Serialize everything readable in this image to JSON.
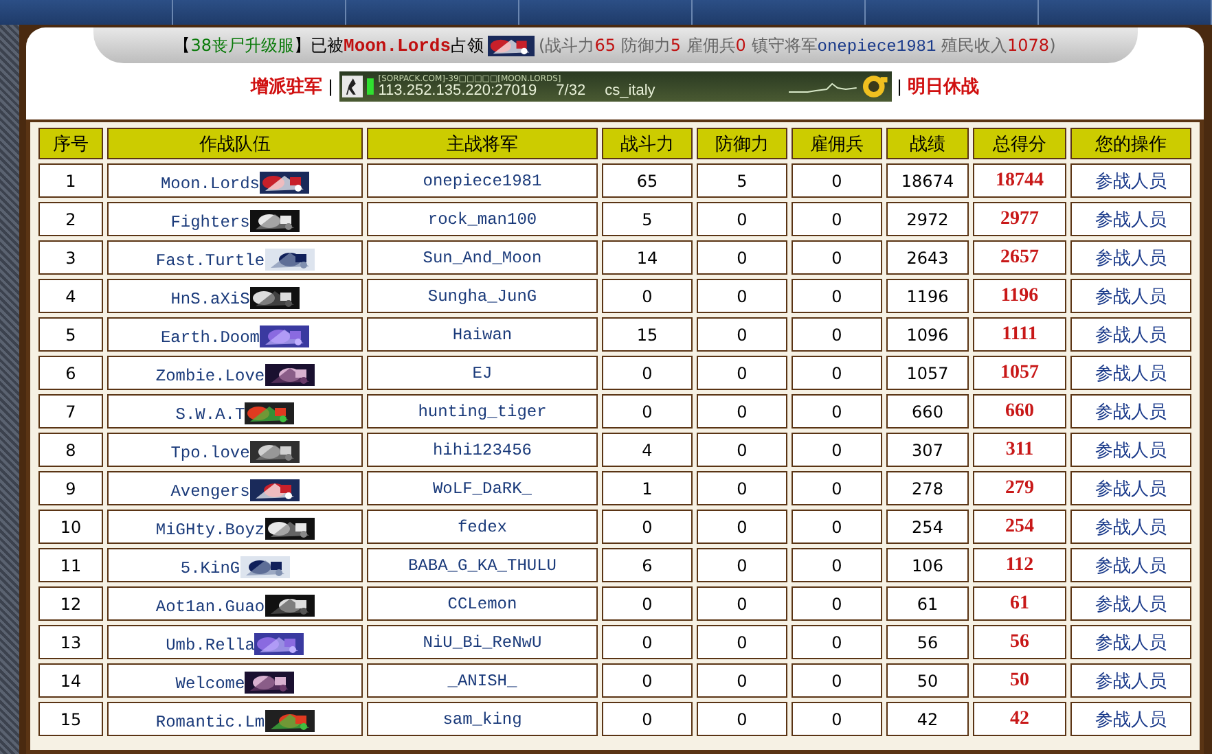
{
  "notice": {
    "before": [
      {
        "kind": "text",
        "text": "【"
      },
      {
        "kind": "server",
        "text": "38丧尸升级服"
      },
      {
        "kind": "text",
        "text": "】已被"
      },
      {
        "kind": "team",
        "text": "Moon.Lords"
      },
      {
        "kind": "text",
        "text": "占领"
      }
    ],
    "after": [
      {
        "kind": "muted",
        "text": "(战斗力"
      },
      {
        "kind": "value",
        "text": "65"
      },
      {
        "kind": "muted",
        "text": " 防御力"
      },
      {
        "kind": "value",
        "text": "5"
      },
      {
        "kind": "muted",
        "text": " 雇佣兵"
      },
      {
        "kind": "value",
        "text": "0"
      },
      {
        "kind": "muted",
        "text": " 镇守将军"
      },
      {
        "kind": "general",
        "text": "onepiece1981"
      },
      {
        "kind": "muted",
        "text": " 殖民收入"
      },
      {
        "kind": "value",
        "text": "1078"
      },
      {
        "kind": "muted",
        "text": ")"
      }
    ]
  },
  "actions": {
    "left": "增派驻军",
    "right": "明日休战",
    "separator": "|"
  },
  "server_banner": {
    "name": "[SORPACK.COM]-39□□□□□[MOON.LORDS]",
    "address": "113.252.135.220:27019",
    "players": "7/32",
    "map": "cs_italy"
  },
  "table": {
    "columns": [
      "序号",
      "作战队伍",
      "主战将军",
      "战斗力",
      "防御力",
      "雇佣兵",
      "战绩",
      "总得分",
      "您的操作"
    ],
    "rows": [
      {
        "rank": "1",
        "team": "Moon.Lords",
        "general": "onepiece1981",
        "attack": "65",
        "defense": "5",
        "mercenaries": "0",
        "record": "18674",
        "total": "18744",
        "action": "参战人员"
      },
      {
        "rank": "2",
        "team": "Fighters",
        "general": "rock_man100",
        "attack": "5",
        "defense": "0",
        "mercenaries": "0",
        "record": "2972",
        "total": "2977",
        "action": "参战人员"
      },
      {
        "rank": "3",
        "team": "Fast.Turtle",
        "general": "Sun_And_Moon",
        "attack": "14",
        "defense": "0",
        "mercenaries": "0",
        "record": "2643",
        "total": "2657",
        "action": "参战人员"
      },
      {
        "rank": "4",
        "team": "HnS.aXiS",
        "general": "Sungha_JunG",
        "attack": "0",
        "defense": "0",
        "mercenaries": "0",
        "record": "1196",
        "total": "1196",
        "action": "参战人员"
      },
      {
        "rank": "5",
        "team": "Earth.Doom",
        "general": "Haiwan",
        "attack": "15",
        "defense": "0",
        "mercenaries": "0",
        "record": "1096",
        "total": "1111",
        "action": "参战人员"
      },
      {
        "rank": "6",
        "team": "Zombie.Love",
        "general": "EJ",
        "attack": "0",
        "defense": "0",
        "mercenaries": "0",
        "record": "1057",
        "total": "1057",
        "action": "参战人员"
      },
      {
        "rank": "7",
        "team": "S.W.A.T",
        "general": "hunting_tiger",
        "attack": "0",
        "defense": "0",
        "mercenaries": "0",
        "record": "660",
        "total": "660",
        "action": "参战人员"
      },
      {
        "rank": "8",
        "team": "Tpo.love",
        "general": "hihi123456",
        "attack": "4",
        "defense": "0",
        "mercenaries": "0",
        "record": "307",
        "total": "311",
        "action": "参战人员"
      },
      {
        "rank": "9",
        "team": "Avengers",
        "general": "WoLF_DaRK_",
        "attack": "1",
        "defense": "0",
        "mercenaries": "0",
        "record": "278",
        "total": "279",
        "action": "参战人员"
      },
      {
        "rank": "10",
        "team": "MiGHty.Boyz",
        "general": "fedex",
        "attack": "0",
        "defense": "0",
        "mercenaries": "0",
        "record": "254",
        "total": "254",
        "action": "参战人员"
      },
      {
        "rank": "11",
        "team": "5.KinG",
        "general": "BABA_G_KA_THULU",
        "attack": "6",
        "defense": "0",
        "mercenaries": "0",
        "record": "106",
        "total": "112",
        "action": "参战人员"
      },
      {
        "rank": "12",
        "team": "Aot1an.Guao",
        "general": "CCLemon",
        "attack": "0",
        "defense": "0",
        "mercenaries": "0",
        "record": "61",
        "total": "61",
        "action": "参战人员"
      },
      {
        "rank": "13",
        "team": "Umb.Rella",
        "general": "NiU_Bi_ReNwU",
        "attack": "0",
        "defense": "0",
        "mercenaries": "0",
        "record": "56",
        "total": "56",
        "action": "参战人员"
      },
      {
        "rank": "14",
        "team": "Welcome",
        "general": "_ANISH_",
        "attack": "0",
        "defense": "0",
        "mercenaries": "0",
        "record": "50",
        "total": "50",
        "action": "参战人员"
      },
      {
        "rank": "15",
        "team": "Romantic.Lm",
        "general": "sam_king",
        "attack": "0",
        "defense": "0",
        "mercenaries": "0",
        "record": "42",
        "total": "42",
        "action": "参战人员"
      }
    ]
  }
}
